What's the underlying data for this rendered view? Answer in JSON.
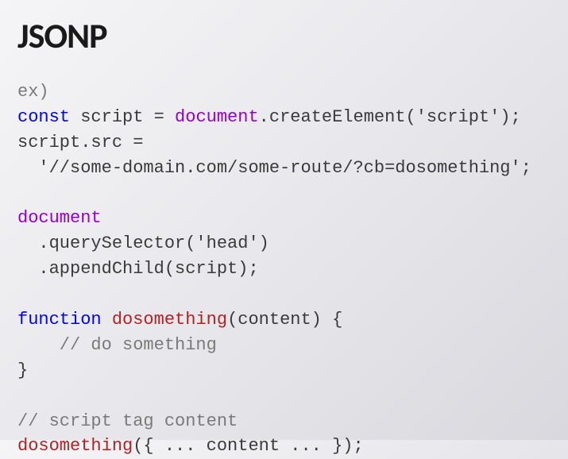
{
  "slide": {
    "title": "JSONP"
  },
  "code": {
    "l1": "ex)",
    "l2_const": "const",
    "l2_script": " script = ",
    "l2_document": "document",
    "l2_rest": ".createElement('script');",
    "l3": "script.src =",
    "l4": "  '//some-domain.com/some-route/?cb=dosomething';",
    "l5": "",
    "l6_document": "document",
    "l7": "  .querySelector('head')",
    "l8": "  .appendChild(script);",
    "l9": "",
    "l10_function": "function",
    "l10_space": " ",
    "l10_name": "dosomething",
    "l10_rest": "(content) {",
    "l11": "    // do something",
    "l12": "}",
    "l13": "",
    "l14": "// script tag content",
    "l15_call": "dosomething",
    "l15_rest": "({ ... content ... });"
  }
}
